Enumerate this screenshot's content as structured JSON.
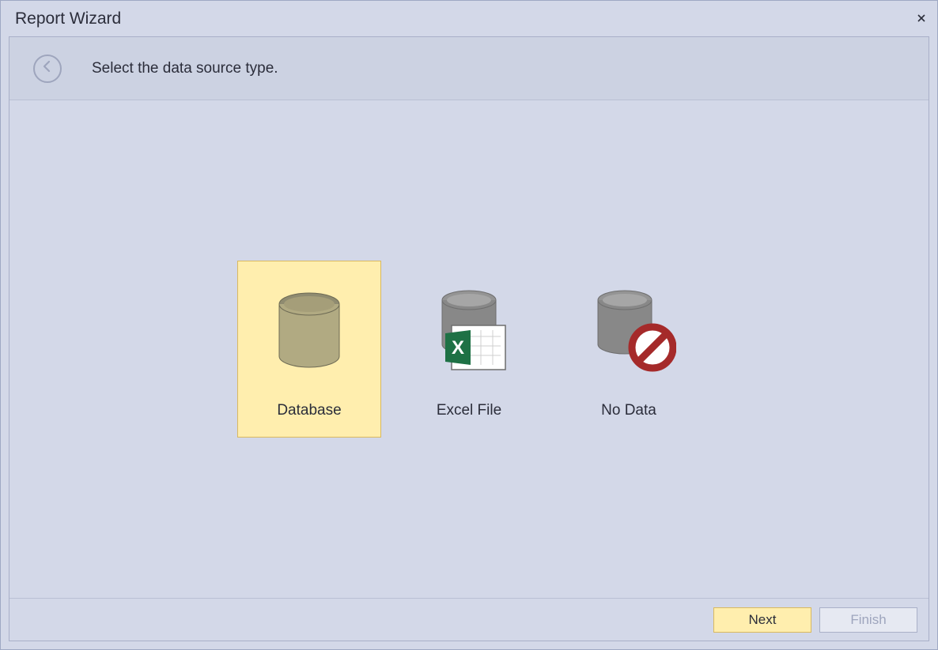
{
  "window": {
    "title": "Report Wizard"
  },
  "instruction": "Select the data source type.",
  "options": [
    {
      "label": "Database",
      "selected": true
    },
    {
      "label": "Excel File",
      "selected": false
    },
    {
      "label": "No Data",
      "selected": false
    }
  ],
  "footer": {
    "next": "Next",
    "finish": "Finish"
  }
}
